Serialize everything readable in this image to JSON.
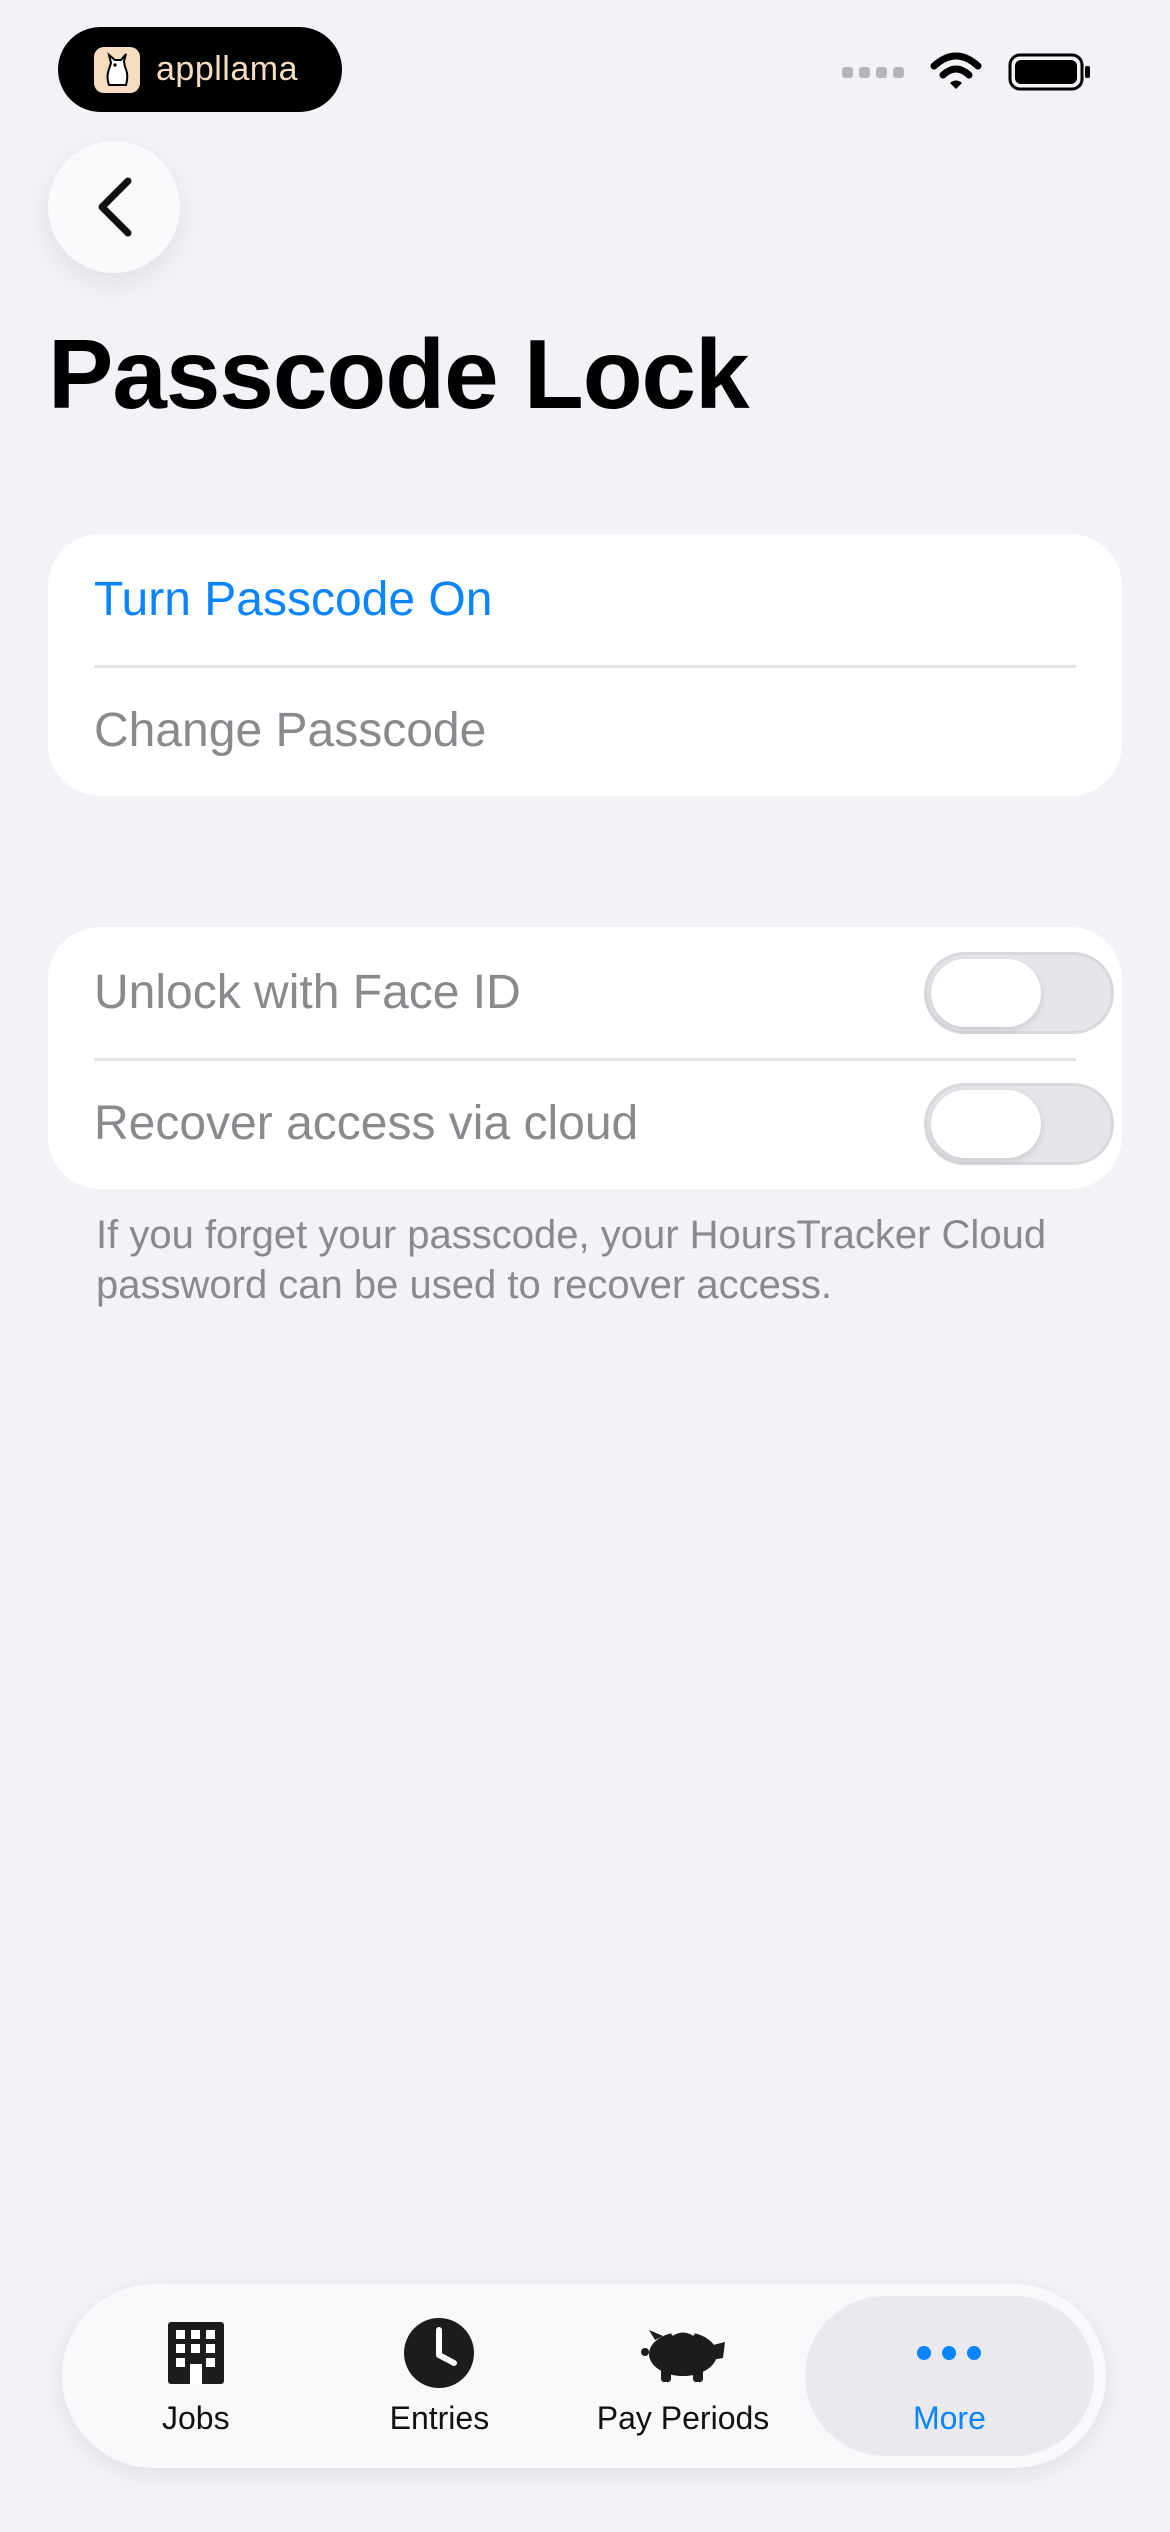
{
  "status_bar": {
    "brand_name": "appllama"
  },
  "header": {
    "title": "Passcode Lock"
  },
  "passcode_group": {
    "turn_on_label": "Turn Passcode On",
    "change_label": "Change Passcode"
  },
  "security_group": {
    "face_id_label": "Unlock with Face ID",
    "face_id_enabled": false,
    "cloud_recovery_label": "Recover access via cloud",
    "cloud_recovery_enabled": false
  },
  "footnote": "If you forget your passcode, your HoursTracker Cloud password can be used to recover access.",
  "tab_bar": {
    "tabs": [
      {
        "label": "Jobs",
        "icon": "building-icon"
      },
      {
        "label": "Entries",
        "icon": "clock-icon"
      },
      {
        "label": "Pay Periods",
        "icon": "piggy-bank-icon"
      },
      {
        "label": "More",
        "icon": "ellipsis-icon"
      }
    ],
    "active": "More"
  },
  "colors": {
    "accent": "#0a84ff",
    "background": "#f2f2f7",
    "muted_text": "#8a8a8e"
  }
}
